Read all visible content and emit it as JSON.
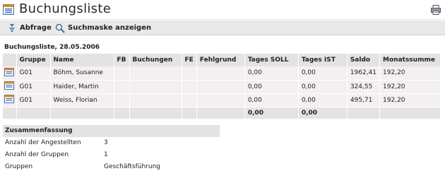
{
  "window": {
    "title": "Buchungsliste"
  },
  "toolbar": {
    "query_label": "Abfrage",
    "search_mask_label": "Suchmaske anzeigen"
  },
  "list": {
    "title": "Buchungsliste, 28.05.2006",
    "headers": [
      "",
      "Gruppe",
      "Name",
      "FB",
      "Buchungen",
      "FE",
      "Fehlgrund",
      "Tages SOLL",
      "Tages IST",
      "Saldo",
      "Monatssumme"
    ],
    "rows": [
      {
        "gruppe": "G01",
        "name": "Böhm, Susanne",
        "fb": "",
        "buchungen": "",
        "fe": "",
        "fehlgrund": "",
        "soll": "0,00",
        "ist": "0,00",
        "saldo": "1962,41",
        "monatssumme": "192,20"
      },
      {
        "gruppe": "G01",
        "name": "Haider, Martin",
        "fb": "",
        "buchungen": "",
        "fe": "",
        "fehlgrund": "",
        "soll": "0,00",
        "ist": "0,00",
        "saldo": "324,55",
        "monatssumme": "192,20"
      },
      {
        "gruppe": "G01",
        "name": "Weiss, Florian",
        "fb": "",
        "buchungen": "",
        "fe": "",
        "fehlgrund": "",
        "soll": "0,00",
        "ist": "0,00",
        "saldo": "495,71",
        "monatssumme": "192,20"
      }
    ],
    "totals": {
      "soll": "0,00",
      "ist": "0,00"
    }
  },
  "summary": {
    "title": "Zusammenfassung",
    "items": [
      {
        "label": "Anzahl der Angestellten",
        "value": "3"
      },
      {
        "label": "Anzahl der Gruppen",
        "value": "1"
      },
      {
        "label": "Gruppen",
        "value": "Geschäftsführung"
      }
    ]
  },
  "icons": {
    "title": "list-icon",
    "print": "printer-icon",
    "query": "query-icon",
    "search_mask": "magnifier-icon",
    "row": "calendar-icon"
  },
  "colors": {
    "header_bg": "#e3e3e3",
    "row_bg": "#f4eff1",
    "toolbar_bg": "#e9e9e9",
    "icon_blue": "#3a6fb0",
    "icon_orange": "#e08a1e"
  }
}
